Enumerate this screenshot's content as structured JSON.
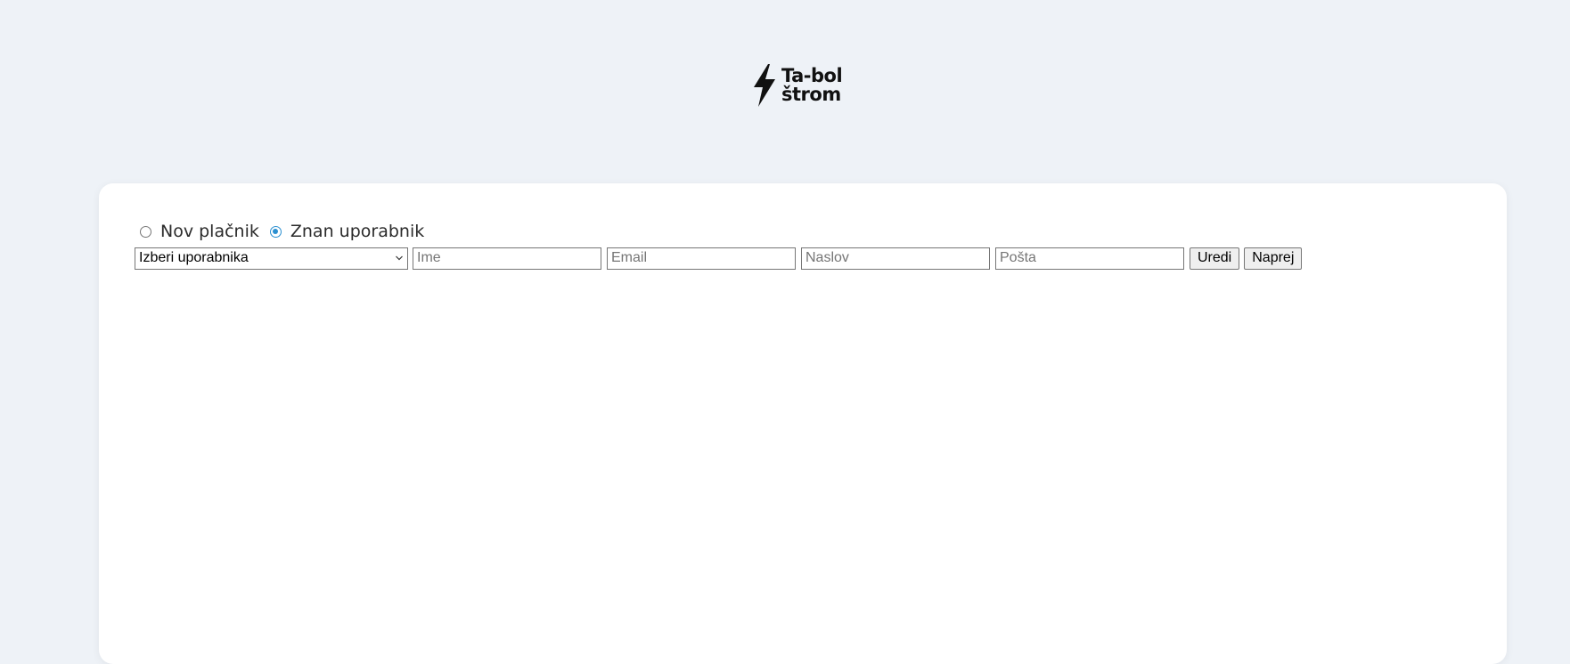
{
  "brand": {
    "line1": "Ta-bol",
    "line2": "štrom"
  },
  "payer_type": {
    "options": [
      {
        "label": "Nov plačnik",
        "checked": false
      },
      {
        "label": "Znan uporabnik",
        "checked": true
      }
    ]
  },
  "form": {
    "user_select": {
      "selected": "Izberi uporabnika"
    },
    "name_input": {
      "placeholder": "Ime",
      "value": ""
    },
    "email_input": {
      "placeholder": "Email",
      "value": ""
    },
    "address_input": {
      "placeholder": "Naslov",
      "value": ""
    },
    "post_input": {
      "placeholder": "Pošta",
      "value": ""
    },
    "edit_button": "Uredi",
    "next_button": "Naprej"
  },
  "colors": {
    "page_background": "#eef2f7",
    "card_background": "#ffffff",
    "radio_accent": "#2a8fd0"
  },
  "icons": {
    "logo": "lightning-bolt-icon",
    "select_arrow": "chevron-down-icon"
  }
}
